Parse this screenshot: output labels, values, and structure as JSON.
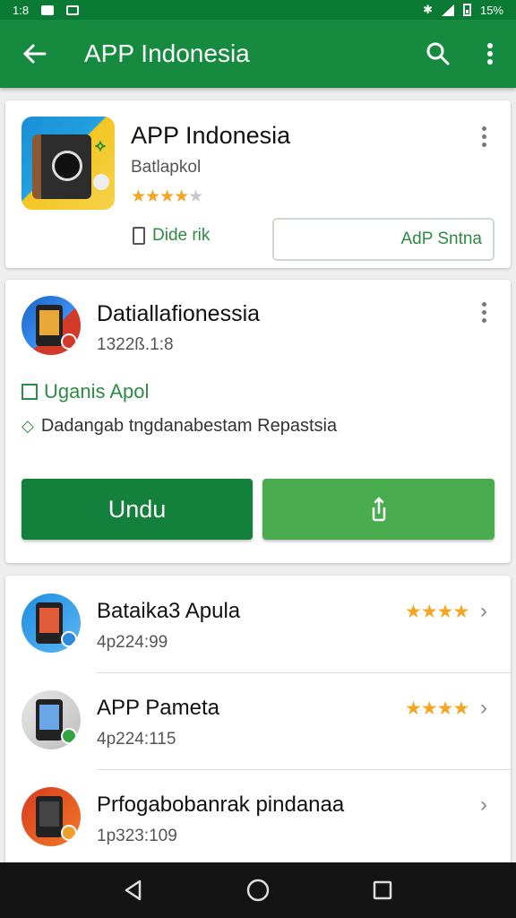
{
  "status_bar": {
    "time": "1:8",
    "battery": "15%"
  },
  "app_bar": {
    "title": "APP Indonesia",
    "icons": [
      "back-arrow-icon",
      "search-icon",
      "more-vert-icon"
    ]
  },
  "app_header": {
    "title": "APP Indonesia",
    "developer": "Batlapkol",
    "rating_stars": 3.5,
    "wishlist_label": "Dide rik",
    "secondary_button_label": "AdP Sntna"
  },
  "featured": {
    "title": "Datiallafionessia",
    "version": "1322ß.1:8",
    "flag_label": "Uganis Apol",
    "description": "Dadangab tngdanabestam Repastsia",
    "install_label": "Undu",
    "share_icon": "share-icon"
  },
  "related": [
    {
      "name": "Bataika3 Apula",
      "meta": "4p224:99",
      "rating": 3.5,
      "stars_text": "★★★★"
    },
    {
      "name": "APP Pameta",
      "meta": "4p224:115",
      "rating": 3.5,
      "stars_text": "★★★★"
    },
    {
      "name": "Prfogabobanrak pindanaa",
      "meta": "1p323:109",
      "rating": null,
      "stars_text": ""
    }
  ],
  "colors": {
    "status_bar": "#0b7a35",
    "app_bar": "#168b3f",
    "install_button": "#13813c",
    "share_button": "#49ad4f",
    "star": "#f4a521",
    "green_text": "#2e8b44"
  },
  "nav_bar": {
    "icons": [
      "back-triangle-icon",
      "home-circle-icon",
      "recents-square-icon"
    ]
  }
}
